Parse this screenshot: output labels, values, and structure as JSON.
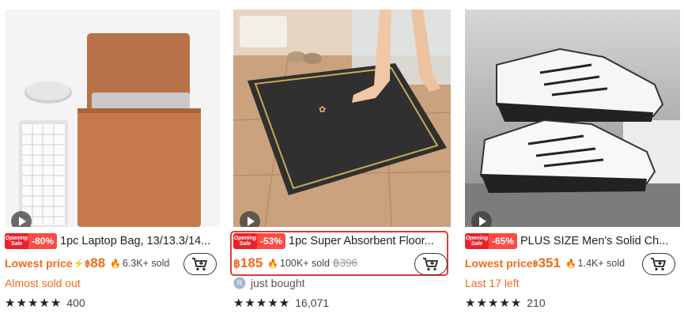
{
  "colors": {
    "accent": "#f26a1b",
    "badge_red": "#e8222b",
    "highlight": "#e23b33"
  },
  "products": [
    {
      "badge_line1": "Opening",
      "badge_line2": "Sale",
      "discount": "-80%",
      "title": "1pc Laptop Bag, 13/13.3/14...",
      "lowest_label": "Lowest price",
      "currency": "฿",
      "price": "88",
      "sold": "6.3K+ sold",
      "status": "Almost sold out",
      "stars": "★★★★★",
      "rating_count": "400"
    },
    {
      "badge_line1": "Opening",
      "badge_line2": "Sale",
      "discount": "-53%",
      "title": "1pc Super Absorbent Floor...",
      "currency": "฿",
      "price": "185",
      "sold": "100K+ sold",
      "original_price": "฿396",
      "avatar_letter": "R",
      "status": "just bought",
      "stars": "★★★★★",
      "rating_count": "16,071"
    },
    {
      "badge_line1": "Opening",
      "badge_line2": "Sale",
      "discount": "-65%",
      "title": "PLUS SIZE Men's Solid Ch...",
      "lowest_label": "Lowest price",
      "currency": "฿",
      "price": "351",
      "sold": "1.4K+ sold",
      "status": "Last 17 left",
      "stars": "★★★★★",
      "rating_count": "210"
    }
  ]
}
